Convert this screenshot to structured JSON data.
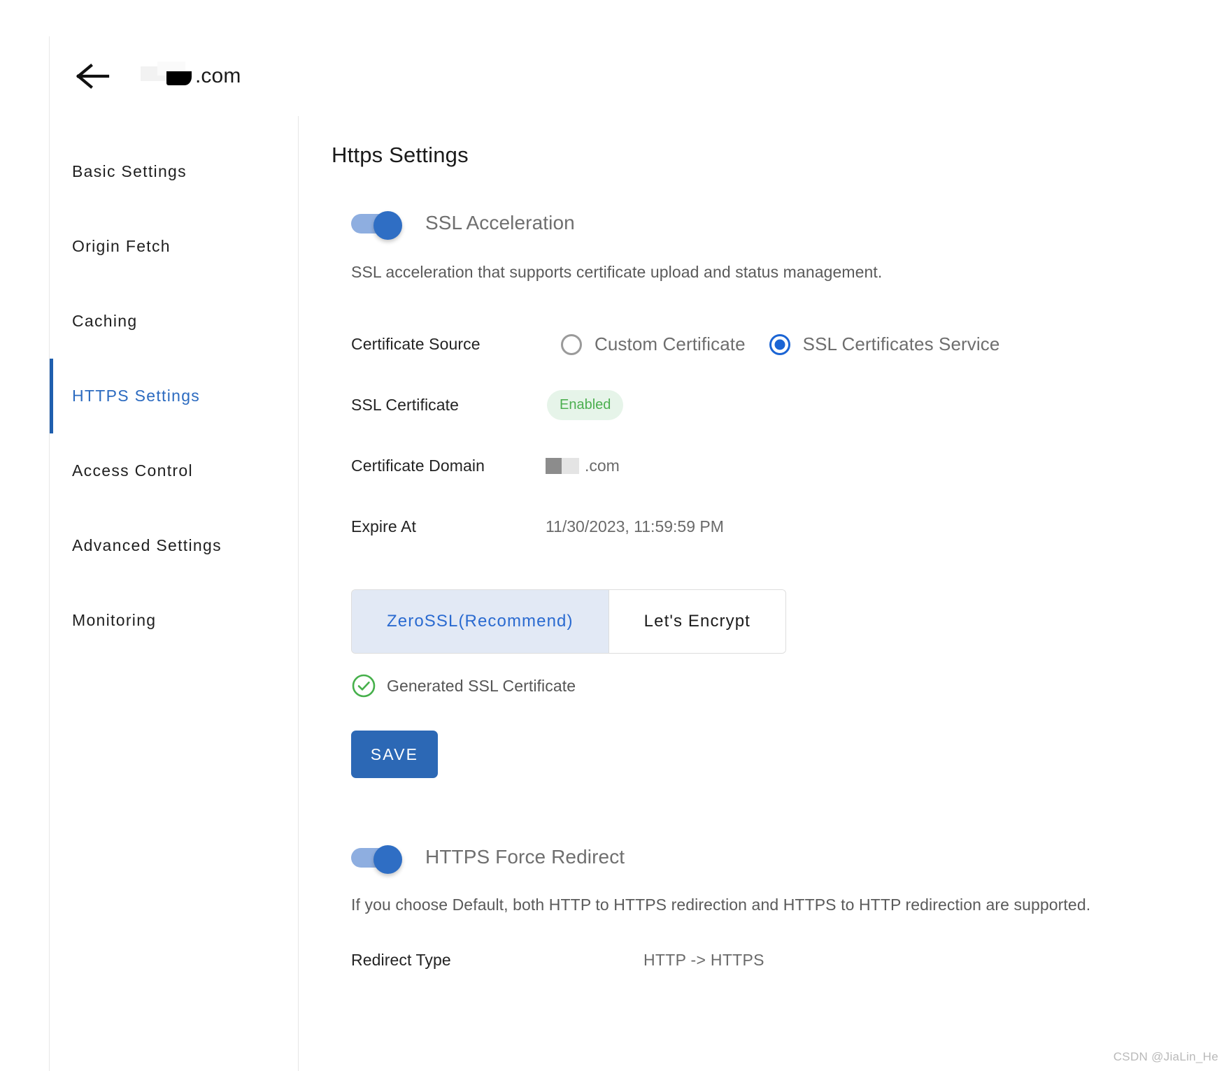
{
  "header": {
    "back_icon": "arrow-left-icon",
    "domain_suffix": ".com",
    "domain_redacted": true
  },
  "sidebar": {
    "items": [
      {
        "label": "Basic Settings",
        "active": false
      },
      {
        "label": "Origin Fetch",
        "active": false
      },
      {
        "label": "Caching",
        "active": false
      },
      {
        "label": "HTTPS Settings",
        "active": true
      },
      {
        "label": "Access Control",
        "active": false
      },
      {
        "label": "Advanced Settings",
        "active": false
      },
      {
        "label": "Monitoring",
        "active": false
      }
    ]
  },
  "main": {
    "title": "Https Settings",
    "ssl_acceleration": {
      "toggle_label": "SSL Acceleration",
      "toggle_on": true,
      "description": "SSL acceleration that supports certificate upload and status management.",
      "fields": [
        {
          "label": "Certificate Source",
          "type": "radio",
          "options": [
            {
              "label": "Custom Certificate",
              "selected": false
            },
            {
              "label": "SSL Certificates Service",
              "selected": true
            }
          ]
        },
        {
          "label": "SSL Certificate",
          "type": "badge",
          "value": "Enabled"
        },
        {
          "label": "Certificate Domain",
          "type": "redacted-text",
          "value": ".com"
        },
        {
          "label": "Expire At",
          "type": "text",
          "value": "11/30/2023, 11:59:59 PM"
        }
      ],
      "tabs": [
        {
          "label": "ZeroSSL(Recommend)",
          "active": true
        },
        {
          "label": "Let's Encrypt",
          "active": false
        }
      ],
      "generated_status": {
        "icon": "check-circle-icon",
        "text": "Generated SSL Certificate"
      },
      "save_label": "SAVE"
    },
    "https_force_redirect": {
      "toggle_label": "HTTPS Force Redirect",
      "toggle_on": true,
      "description": "If you choose Default, both HTTP to HTTPS redirection and HTTPS to HTTP redirection are supported.",
      "fields": [
        {
          "label": "Redirect Type",
          "value": "HTTP -> HTTPS"
        }
      ]
    }
  },
  "watermark": "CSDN @JiaLin_He",
  "colors": {
    "accent_blue": "#2c6bc0",
    "save_blue": "#2c68b5",
    "toggle_knob": "#2f6ec4",
    "toggle_track": "#8eaee0",
    "badge_green_text": "#4caf50",
    "badge_green_bg": "#e6f4e9",
    "tab_active_bg": "#e2e9f5"
  }
}
